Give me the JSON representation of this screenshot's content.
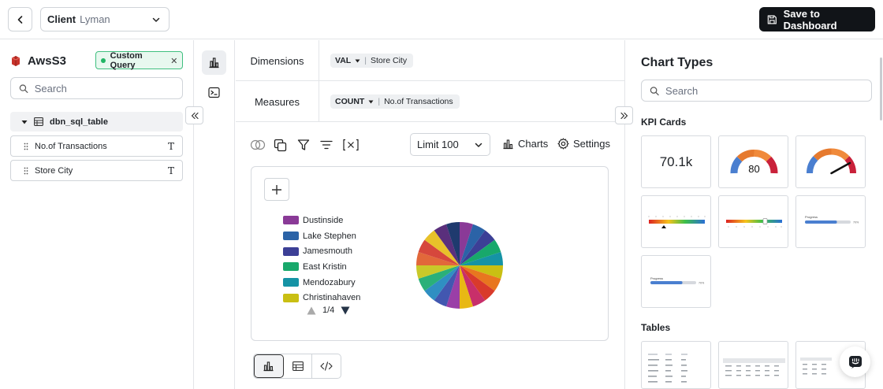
{
  "topbar": {
    "client_label": "Client",
    "client_value": "Lyman",
    "save_label": "Save to Dashboard"
  },
  "left": {
    "source_name": "AwsS3",
    "custom_query_label": "Custom Query",
    "search_placeholder": "Search",
    "table_name": "dbn_sql_table",
    "fields": [
      {
        "name": "No.of Transactions",
        "type": "T"
      },
      {
        "name": "Store City",
        "type": "T"
      }
    ]
  },
  "query": {
    "dimensions_label": "Dimensions",
    "dimension": {
      "agg": "VAL",
      "field": "Store City"
    },
    "measures_label": "Measures",
    "measure": {
      "agg": "COUNT",
      "field": "No.of Transactions"
    }
  },
  "toolbar": {
    "limit_label": "Limit 100",
    "charts_label": "Charts",
    "settings_label": "Settings"
  },
  "chart_data": {
    "type": "pie",
    "legend": [
      {
        "name": "Dustinside",
        "color": "#8a3a97"
      },
      {
        "name": "Lake Stephen",
        "color": "#2b63a7"
      },
      {
        "name": "Jamesmouth",
        "color": "#3c3f96"
      },
      {
        "name": "East Kristin",
        "color": "#18a86b"
      },
      {
        "name": "Mendozabury",
        "color": "#1593a5"
      },
      {
        "name": "Christinahaven",
        "color": "#c9bf13"
      }
    ],
    "page": "1/4",
    "slice_colors": [
      "#8a3a97",
      "#2b63a7",
      "#3c3f96",
      "#18a86b",
      "#1593a5",
      "#c9bf13",
      "#e8761f",
      "#d93a2b",
      "#c82f6a",
      "#e8b814",
      "#9a3fa7",
      "#4257b0",
      "#2f8fc2",
      "#2ab079",
      "#c9c929",
      "#e2683a",
      "#d6473c",
      "#e8c12a",
      "#5a2f7c",
      "#1f3a6e"
    ]
  },
  "right": {
    "title": "Chart Types",
    "search_placeholder": "Search",
    "kpi_section": "KPI Cards",
    "kpi_value": "70.1k",
    "gauge_value": "80",
    "tables_section": "Tables",
    "progress_label": "Progress",
    "progress_pct": "70%",
    "progress_fraction": 0.7
  }
}
